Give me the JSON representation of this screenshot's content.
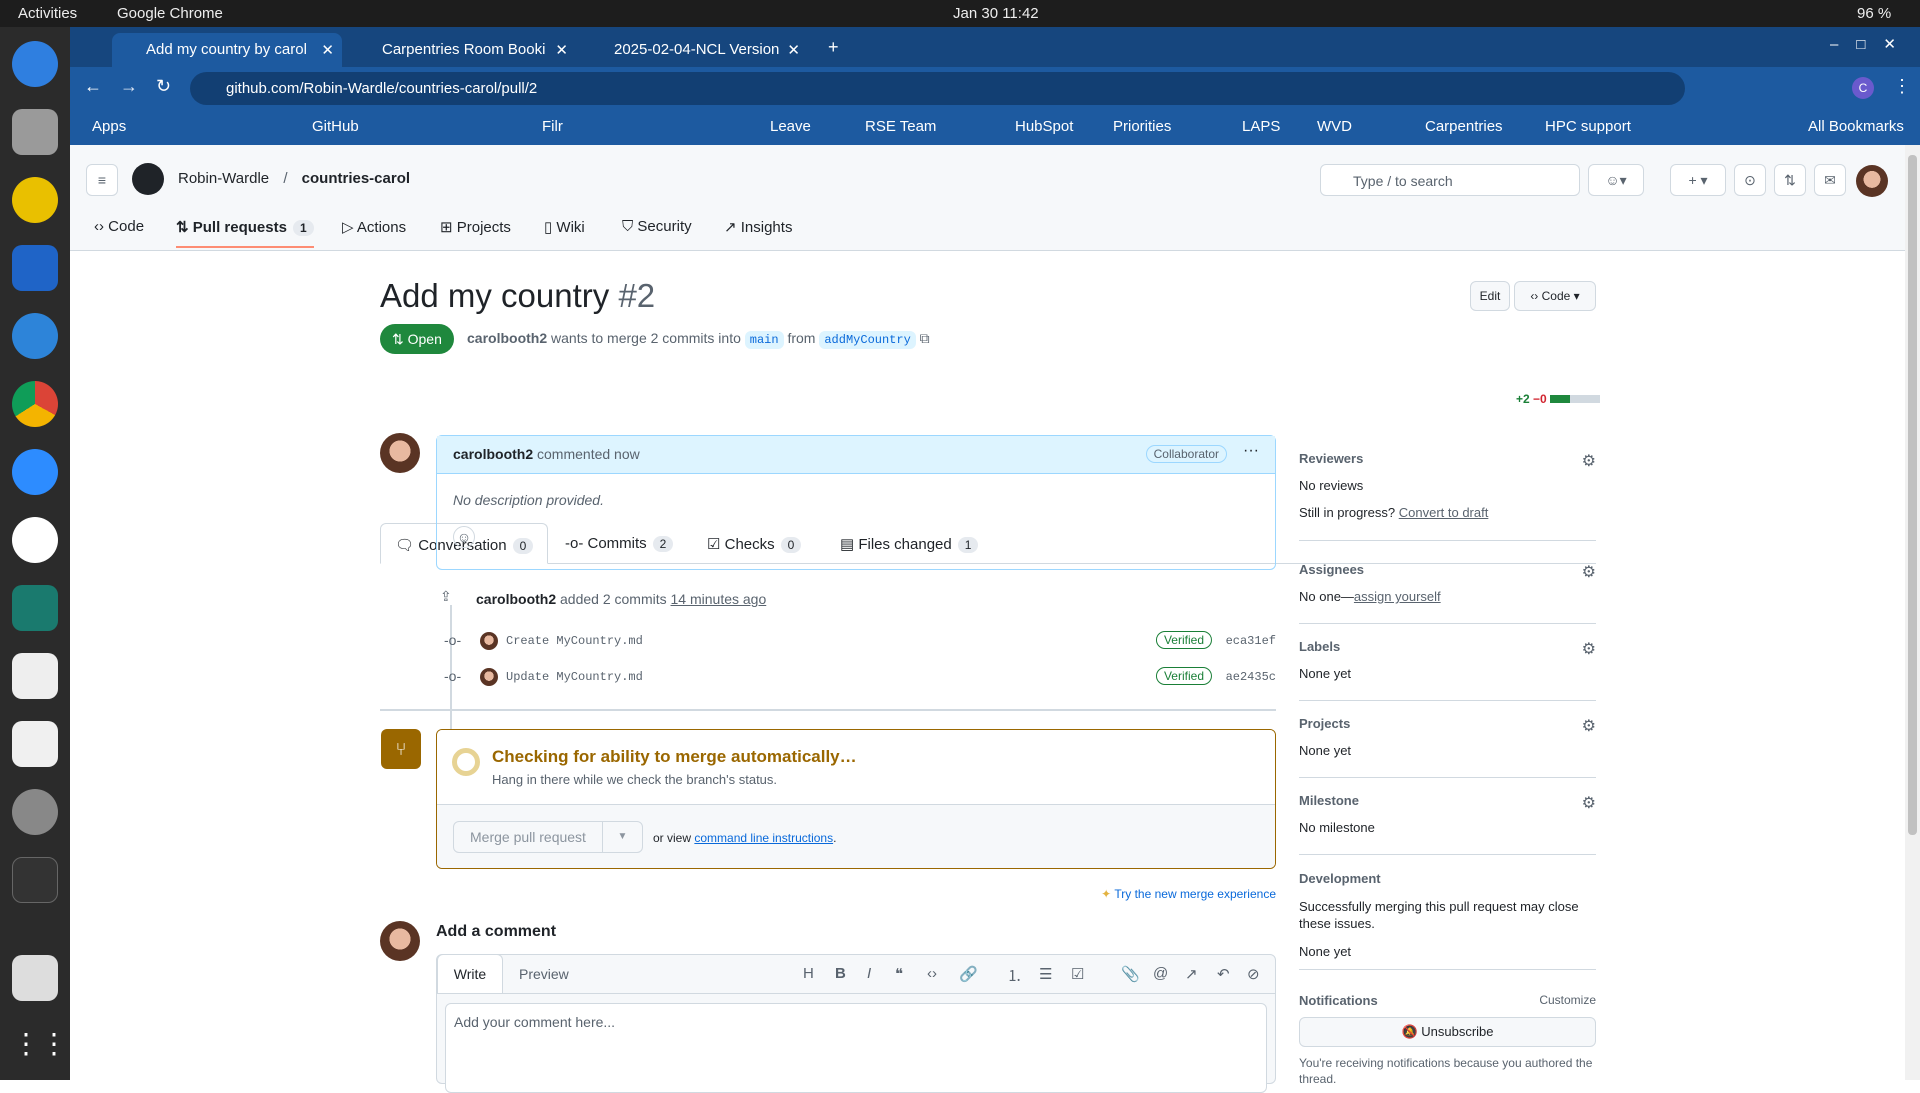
{
  "system": {
    "activities": "Activities",
    "app": "Google Chrome",
    "datetime": "Jan 30  11:42",
    "battery": "96 %"
  },
  "browser": {
    "tabs": [
      {
        "label": "Add my country by carol"
      },
      {
        "label": "Carpentries Room Booki"
      },
      {
        "label": "2025-02-04-NCL Version"
      }
    ],
    "url": "github.com/Robin-Wardle/countries-carol/pull/2",
    "profile": "C",
    "bookmarks": [
      "Apps",
      "GitHub",
      "Filr",
      "Leave",
      "RSE Team",
      "HubSpot",
      "Priorities",
      "LAPS",
      "WVD",
      "Carpentries",
      "HPC support",
      "All Bookmarks"
    ]
  },
  "repo": {
    "owner": "Robin-Wardle",
    "sep": "/",
    "name": "countries-carol",
    "search_placeholder": "Type / to search",
    "nav": [
      {
        "label": "Code"
      },
      {
        "label": "Pull requests",
        "count": "1"
      },
      {
        "label": "Actions"
      },
      {
        "label": "Projects"
      },
      {
        "label": "Wiki"
      },
      {
        "label": "Security"
      },
      {
        "label": "Insights"
      }
    ]
  },
  "pr": {
    "title": "Add my country",
    "number": "#2",
    "edit": "Edit",
    "code": "Code",
    "state": "Open",
    "author": "carolbooth2",
    "summary": "wants to merge 2 commits into",
    "base": "main",
    "from": "from",
    "head": "addMyCountry",
    "tabs": [
      {
        "label": "Conversation",
        "count": "0"
      },
      {
        "label": "Commits",
        "count": "2"
      },
      {
        "label": "Checks",
        "count": "0"
      },
      {
        "label": "Files changed",
        "count": "1"
      }
    ],
    "additions": "+2",
    "deletions": "−0"
  },
  "comment": {
    "author": "carolbooth2",
    "meta": "commented now",
    "role": "Collaborator",
    "body": "No description provided."
  },
  "commits_event": {
    "author": "carolbooth2",
    "text": "added 2 commits",
    "time": "14 minutes ago",
    "commits": [
      {
        "message": "Create MyCountry.md",
        "status": "Verified",
        "sha": "eca31ef"
      },
      {
        "message": "Update MyCountry.md",
        "status": "Verified",
        "sha": "ae2435c"
      }
    ]
  },
  "merge": {
    "title": "Checking for ability to merge automatically…",
    "subtitle": "Hang in there while we check the branch's status.",
    "button": "Merge pull request",
    "or_view": "or view",
    "cli_link": "command line instructions",
    "period": ".",
    "try_new": "Try the new merge experience"
  },
  "add_comment": {
    "heading": "Add a comment",
    "write": "Write",
    "preview": "Preview",
    "placeholder": "Add your comment here..."
  },
  "sidebar": {
    "reviewers": {
      "title": "Reviewers",
      "value": "No reviews",
      "draft_q": "Still in progress?",
      "draft_link": "Convert to draft"
    },
    "assignees": {
      "title": "Assignees",
      "value": "No one—",
      "link": "assign yourself"
    },
    "labels": {
      "title": "Labels",
      "value": "None yet"
    },
    "projects": {
      "title": "Projects",
      "value": "None yet"
    },
    "milestone": {
      "title": "Milestone",
      "value": "No milestone"
    },
    "development": {
      "title": "Development",
      "desc": "Successfully merging this pull request may close these issues.",
      "value": "None yet"
    },
    "notifications": {
      "title": "Notifications",
      "customize": "Customize",
      "button": "Unsubscribe",
      "reason": "You're receiving notifications because you authored the thread."
    }
  },
  "colors": {
    "open": "#1f883d",
    "attention": "#9a6700",
    "link": "#0969da"
  }
}
